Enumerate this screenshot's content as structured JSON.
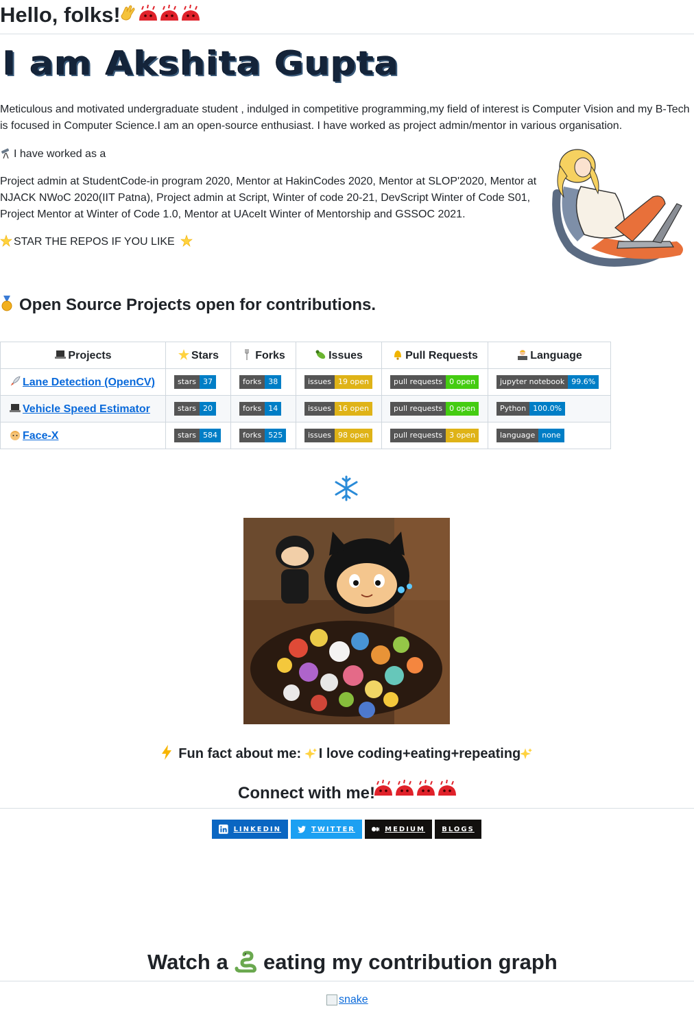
{
  "header": {
    "greeting": "Hello, folks!"
  },
  "name_banner": "I am Akshita Gupta",
  "bio": "Meticulous and motivated undergraduate student , indulged in competitive programming,my field of interest is Computer Vision and my B-Tech is focused in Computer Science.I am an open-source enthusiast. I have worked as project admin/mentor in various organisation.",
  "worked_intro": "I have worked as a",
  "roles": "Project admin at StudentCode-in program 2020, Mentor at HakinCodes 2020, Mentor at SLOP'2020, Mentor at NJACK NWoC 2020(IIT Patna), Project admin at Script, Winter of code 20-21, DevScript Winter of Code S01, Project Mentor at Winter of Code 1.0, Mentor at UAceIt Winter of Mentorship and GSSOC 2021.",
  "star_repos": "STAR THE REPOS IF YOU LIKE",
  "open_source_heading": "Open Source Projects open for contributions.",
  "table": {
    "headers": [
      "Projects",
      "Stars",
      "Forks",
      "Issues",
      "Pull Requests",
      "Language"
    ],
    "rows": [
      {
        "name": "Lane Detection (OpenCV)",
        "stars": {
          "k": "stars",
          "v": "37"
        },
        "forks": {
          "k": "forks",
          "v": "38"
        },
        "issues": {
          "k": "issues",
          "v": "19 open"
        },
        "prs": {
          "k": "pull requests",
          "v": "0 open"
        },
        "lang": {
          "k": "jupyter notebook",
          "v": "99.6%"
        }
      },
      {
        "name": "Vehicle Speed Estimator",
        "stars": {
          "k": "stars",
          "v": "20"
        },
        "forks": {
          "k": "forks",
          "v": "14"
        },
        "issues": {
          "k": "issues",
          "v": "16 open"
        },
        "prs": {
          "k": "pull requests",
          "v": "0 open"
        },
        "lang": {
          "k": "Python",
          "v": "100.0%"
        }
      },
      {
        "name": "Face-X",
        "stars": {
          "k": "stars",
          "v": "584"
        },
        "forks": {
          "k": "forks",
          "v": "525"
        },
        "issues": {
          "k": "issues",
          "v": "98 open"
        },
        "prs": {
          "k": "pull requests",
          "v": "3 open"
        },
        "lang": {
          "k": "language",
          "v": "none"
        }
      }
    ]
  },
  "fun_fact": {
    "label": "Fun fact about me:",
    "text": "I love coding+eating+repeating"
  },
  "connect_heading": "Connect with me!",
  "social": {
    "linkedin": "LINKEDIN",
    "twitter": "TWITTER",
    "medium": "MEDIUM",
    "blogs": "BLOGS"
  },
  "snake": {
    "heading_before": "Watch a",
    "heading_after": "eating my contribution graph",
    "alt": "snake"
  },
  "colors": {
    "link": "#0969da",
    "badge_label": "#555555",
    "badge_blue": "#007ec6",
    "badge_green": "#44cc11",
    "badge_yellow": "#dfb317",
    "linkedin": "#0a66c2",
    "twitter": "#1ca0f2",
    "medium": "#12100e"
  },
  "icons": [
    "waving-hand-icon",
    "red-monster-icon",
    "telescope-icon",
    "star-icon",
    "medal-icon",
    "laptop-icon",
    "fork-icon",
    "bug-icon",
    "bell-icon",
    "technologist-icon",
    "rocket-icon",
    "boy-icon",
    "snowflake-icon",
    "lightning-icon",
    "sparkles-icon",
    "linkedin-icon",
    "twitter-icon",
    "medium-icon",
    "snake-icon",
    "broken-image-icon"
  ]
}
